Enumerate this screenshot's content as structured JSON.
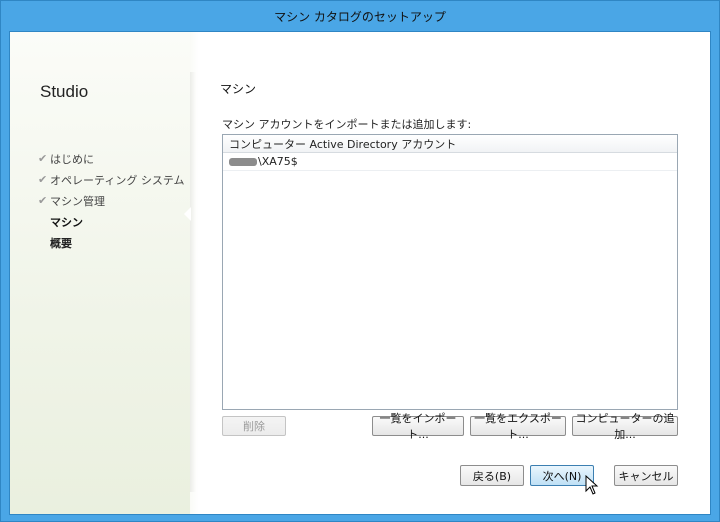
{
  "window": {
    "title": "マシン カタログのセットアップ"
  },
  "sidebar": {
    "brand": "Studio",
    "steps": [
      {
        "label": "はじめに",
        "state": "done"
      },
      {
        "label": "オペレーティング システム",
        "state": "done"
      },
      {
        "label": "マシン管理",
        "state": "done"
      },
      {
        "label": "マシン",
        "state": "active"
      },
      {
        "label": "概要",
        "state": "pending"
      }
    ]
  },
  "main": {
    "title": "マシン",
    "instruction": "マシン アカウントをインポートまたは追加します:",
    "list": {
      "header": "コンピューター Active Directory アカウント",
      "rows": [
        "\\XA75$"
      ]
    },
    "buttons": {
      "delete": "削除",
      "import": "一覧をインポート...",
      "export": "一覧をエクスポート...",
      "add_computer": "コンピューターの追加..."
    }
  },
  "footer": {
    "back": "戻る(B)",
    "next": "次へ(N)",
    "cancel": "キャンセル"
  },
  "colors": {
    "titlebar": "#4aa6e6",
    "primary_button": "#bfe0f5"
  }
}
